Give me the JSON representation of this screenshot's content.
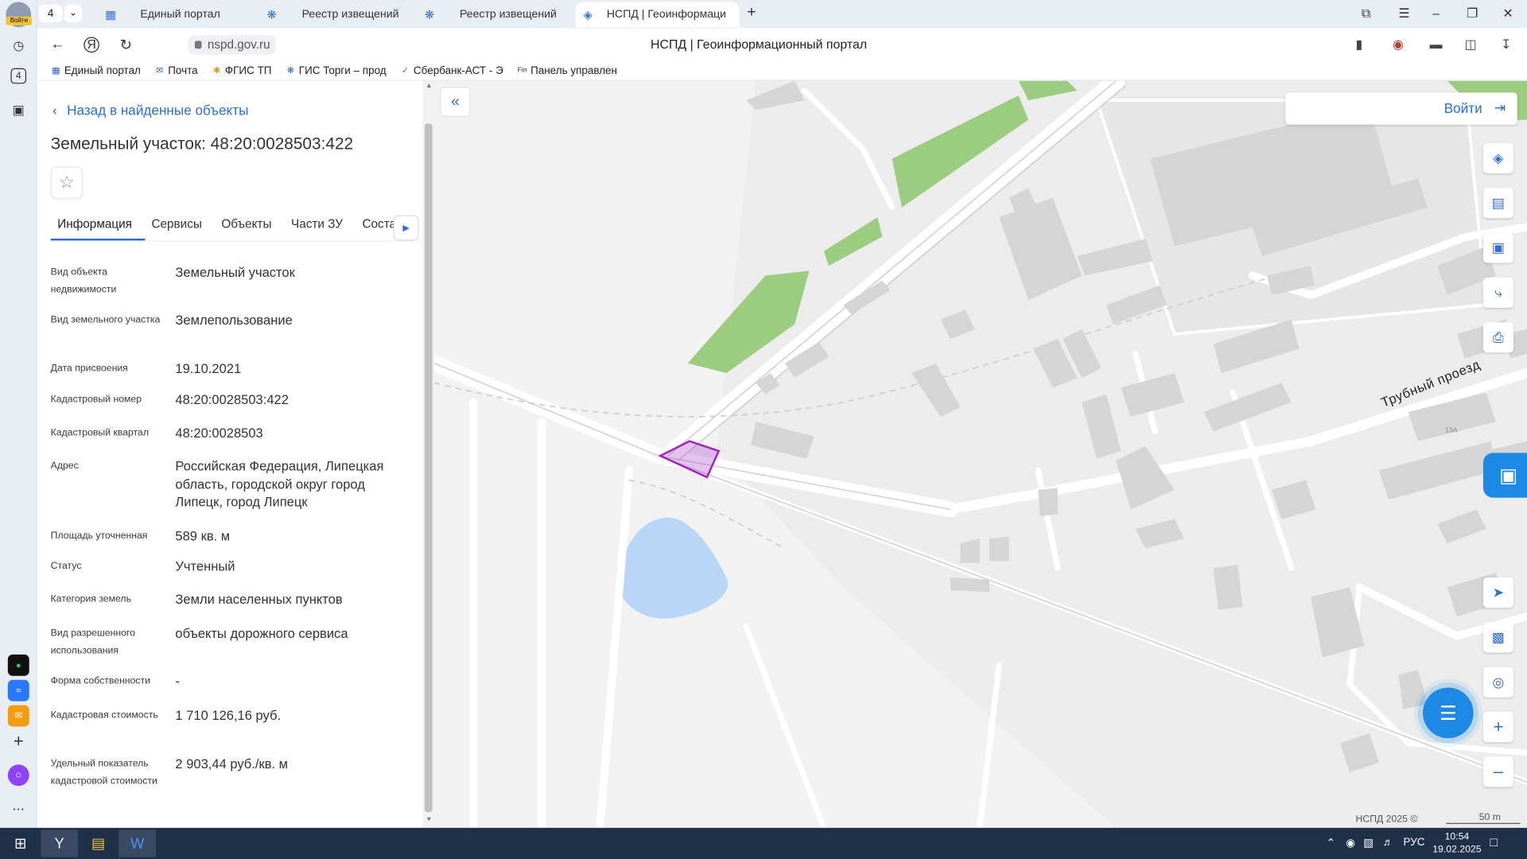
{
  "browser": {
    "tab_count": "4",
    "login_badge": "Войти",
    "tabs": [
      {
        "title": "Единый портал",
        "active": false
      },
      {
        "title": "Реестр извещений",
        "active": false
      },
      {
        "title": "Реестр извещений",
        "active": false
      },
      {
        "title": "НСПД | Геоинформаци",
        "active": true
      }
    ],
    "url": "nspd.gov.ru",
    "page_title": "НСПД | Геоинформационный портал",
    "bookmarks": [
      "Единый портал",
      "Почта",
      "ФГИС ТП",
      "ГИС Торги – прод",
      "Сбербанк-АСТ - Э",
      "Панель управлен"
    ]
  },
  "panel": {
    "back_label": "Назад в найденные объекты",
    "title": "Земельный участок: 48:20:0028503:422",
    "tabs": [
      "Информация",
      "Сервисы",
      "Объекты",
      "Части ЗУ",
      "Соста"
    ],
    "fields": [
      {
        "label": "Вид объекта недвижимости",
        "value": "Земельный участок"
      },
      {
        "label": "Вид земельного участка",
        "value": "Землепользование"
      },
      {
        "label": "Дата присвоения",
        "value": "19.10.2021"
      },
      {
        "label": "Кадастровый номер",
        "value": "48:20:0028503:422"
      },
      {
        "label": "Кадастровый квартал",
        "value": "48:20:0028503"
      },
      {
        "label": "Адрес",
        "value": "Российская Федерация, Липецкая область, городской округ город Липецк, город Липецк"
      },
      {
        "label": "Площадь уточненная",
        "value": "589 кв. м"
      },
      {
        "label": "Статус",
        "value": "Учтенный"
      },
      {
        "label": "Категория земель",
        "value": "Земли населенных пунктов"
      },
      {
        "label": "Вид разрешенного использования",
        "value": "объекты дорожного сервиса"
      },
      {
        "label": "Форма собственности",
        "value": "-"
      },
      {
        "label": "Кадастровая стоимость",
        "value": "1 710 126,16 руб."
      },
      {
        "label": "Удельный показатель кадастровой стоимости",
        "value": "2 903,44 руб./кв. м"
      }
    ]
  },
  "map": {
    "login_label": "Войти",
    "street_label": "Трубный проезд",
    "house_number": "13А",
    "copyright": "НСПД 2025 ©",
    "scale_label": "50 m",
    "colors": {
      "parcel": "#a020c0",
      "water": "#b9d6f7",
      "park": "#9ccc80",
      "building": "#d5d5d5"
    }
  },
  "taskbar": {
    "lang": "РУС",
    "time": "10:54",
    "date": "19.02.2025"
  }
}
